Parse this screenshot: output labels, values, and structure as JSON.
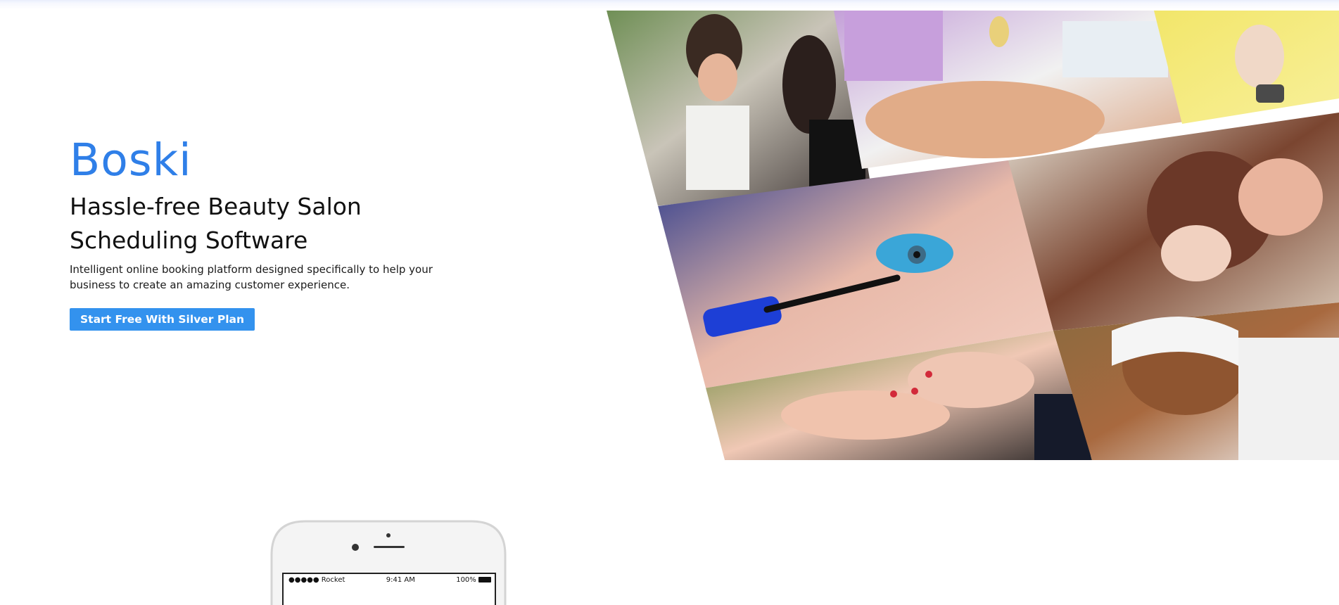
{
  "hero": {
    "brand": "Boski",
    "headline_line1": "Hassle-free Beauty Salon",
    "headline_line2": "Scheduling Software",
    "tagline_line1": "Intelligent online booking platform designed specifically to help your",
    "tagline_line2": "business to create an amazing customer experience.",
    "cta_label": "Start Free With Silver Plan"
  },
  "collage": {
    "tiles": [
      {
        "name": "makeup-application-photo"
      },
      {
        "name": "back-massage-photo"
      },
      {
        "name": "hand-watch-photo"
      },
      {
        "name": "mascara-eye-photo"
      },
      {
        "name": "hair-styling-photo"
      },
      {
        "name": "manicure-photo"
      },
      {
        "name": "facial-mask-photo"
      }
    ]
  },
  "phone": {
    "carrier": "●●●●● Rocket",
    "time": "9:41 AM",
    "battery": "100%"
  },
  "colors": {
    "brand": "#2f7fe8",
    "cta_background": "#3392ee"
  }
}
